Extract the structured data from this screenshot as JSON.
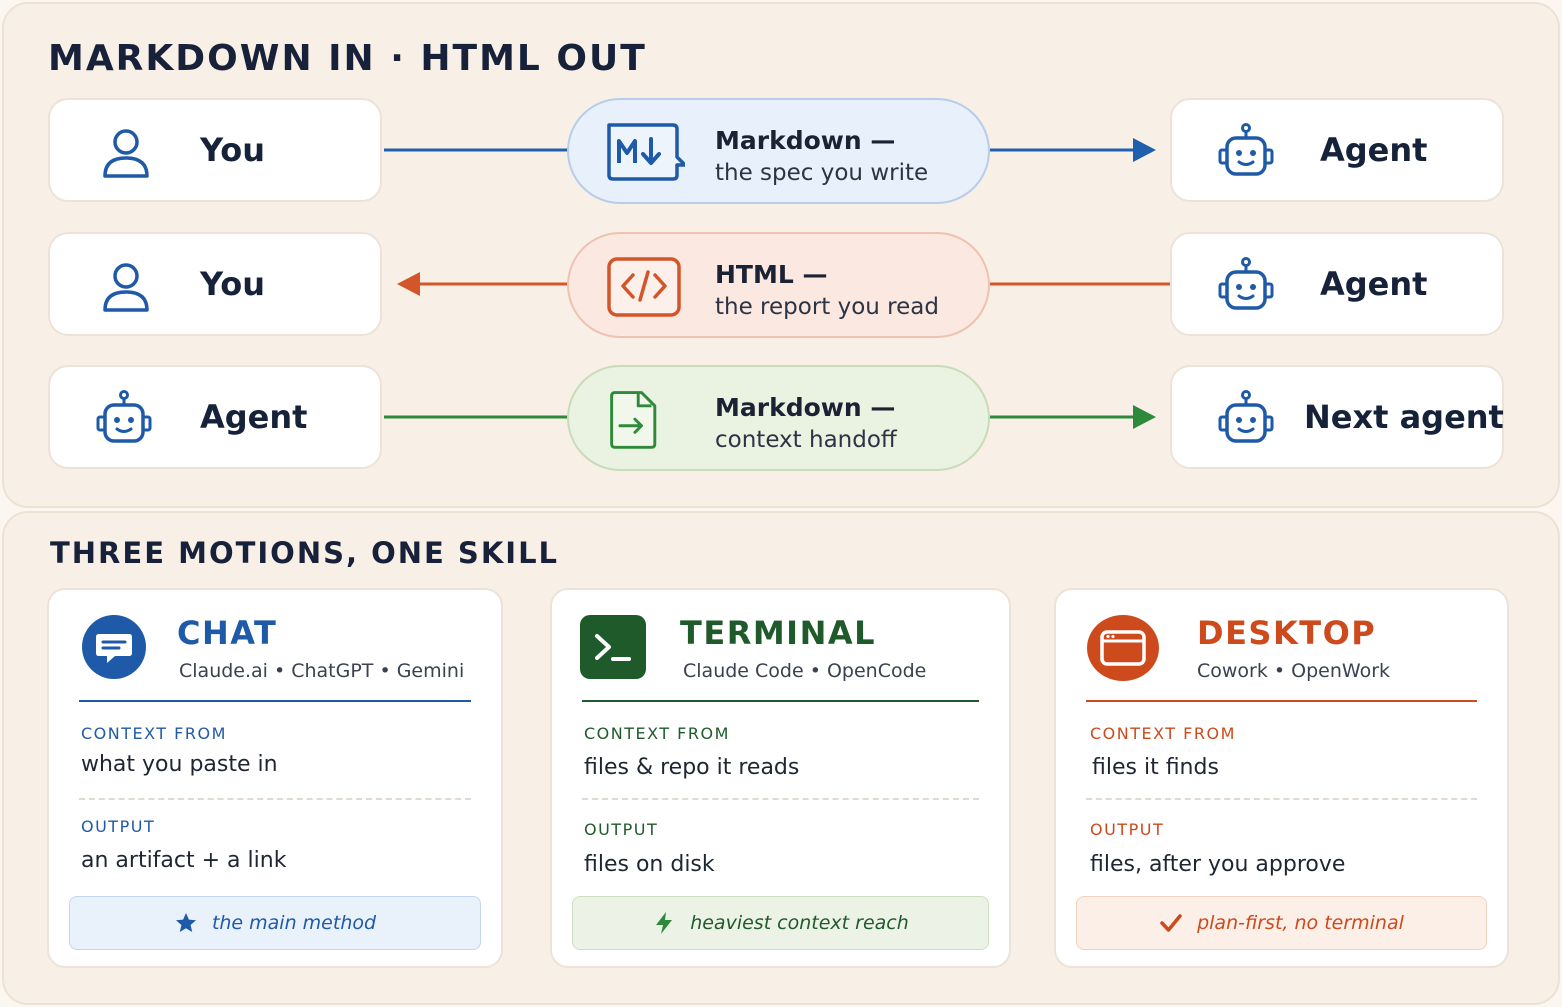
{
  "top": {
    "title": "MARKDOWN IN · HTML OUT",
    "rows": [
      {
        "left_label": "You",
        "left_icon": "person-icon",
        "pill_title": "Markdown —",
        "pill_subtitle": "the spec you write",
        "pill_icon": "markdown-icon",
        "right_label": "Agent",
        "right_icon": "robot-icon",
        "direction": "right",
        "color": "#1f5fae"
      },
      {
        "left_label": "You",
        "left_icon": "person-icon",
        "pill_title": "HTML —",
        "pill_subtitle": "the report you read",
        "pill_icon": "code-icon",
        "right_label": "Agent",
        "right_icon": "robot-icon",
        "direction": "left",
        "color": "#d2562a"
      },
      {
        "left_label": "Agent",
        "left_icon": "robot-icon",
        "pill_title": "Markdown —",
        "pill_subtitle": "context handoff",
        "pill_icon": "file-arrow-icon",
        "right_label": "Next agent",
        "right_icon": "robot-icon",
        "direction": "right",
        "color": "#2e8a3a"
      }
    ]
  },
  "bottom": {
    "title": "THREE MOTIONS, ONE SKILL",
    "cards": [
      {
        "title": "CHAT",
        "icon": "chat-bubble-icon",
        "tools": "Claude.ai  •  ChatGPT • Gemini",
        "context_label": "CONTEXT FROM",
        "context_value": "what you paste in",
        "output_label": "OUTPUT",
        "output_value": "an artifact + a link",
        "badge_icon": "star-icon",
        "badge_text": "the main method",
        "accent": "#1f5aa8"
      },
      {
        "title": "TERMINAL",
        "icon": "terminal-icon",
        "tools": "Claude Code  •  OpenCode",
        "context_label": "CONTEXT FROM",
        "context_value": "files & repo it reads",
        "output_label": "OUTPUT",
        "output_value": "files on disk",
        "badge_icon": "lightning-icon",
        "badge_text": "heaviest context reach",
        "accent": "#1f5a2a"
      },
      {
        "title": "DESKTOP",
        "icon": "window-icon",
        "tools": "Cowork  •  OpenWork",
        "context_label": "CONTEXT FROM",
        "context_value": "files it finds",
        "output_label": "OUTPUT",
        "output_value": "files, after you approve",
        "badge_icon": "check-icon",
        "badge_text": "plan-first, no terminal",
        "accent": "#cc4a1c"
      }
    ]
  }
}
